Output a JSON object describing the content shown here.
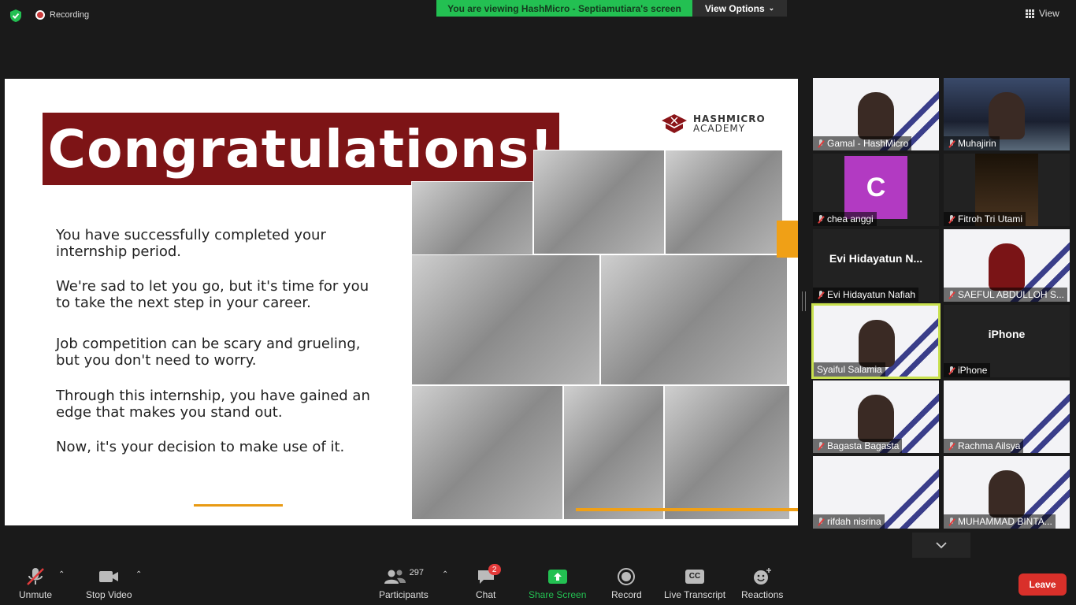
{
  "topbar": {
    "recording_label": "Recording",
    "viewing_banner": "You are viewing HashMicro - Septiamutiara's screen",
    "view_options": "View Options",
    "view_label": "View"
  },
  "slide": {
    "title": "Congratulations!",
    "logo_line1": "HASHMICRO",
    "logo_line2": "ACADEMY",
    "paragraphs": [
      "You have successfully completed your internship period.",
      "We're sad to let you go, but it's time for you to take the next step in your career.",
      "Job competition can be scary and grueling, but you don't need to worry.",
      "Through this internship, you have gained an edge that makes you stand out.",
      "Now, it's your decision to make use of it."
    ]
  },
  "participants": [
    {
      "name": "Gamal - HashMicro"
    },
    {
      "name": "Muhajirin"
    },
    {
      "name": "chea anggi",
      "avatar": "C"
    },
    {
      "name": "Fitroh Tri Utami"
    },
    {
      "name": "Evi Hidayatun Nafiah",
      "center": "Evi  Hidayatun  N..."
    },
    {
      "name": "SAEFUL ABDULLOH S..."
    },
    {
      "name": "Syaiful Salamia"
    },
    {
      "name": "iPhone",
      "center": "iPhone"
    },
    {
      "name": "Bagasta Bagasta"
    },
    {
      "name": "Rachma Ailsya"
    },
    {
      "name": "rifdah nisrina"
    },
    {
      "name": "MUHAMMAD BINTA..."
    }
  ],
  "toolbar": {
    "unmute": "Unmute",
    "stop_video": "Stop Video",
    "participants": "Participants",
    "participants_count": "297",
    "chat": "Chat",
    "chat_badge": "2",
    "share_screen": "Share Screen",
    "record": "Record",
    "live_transcript": "Live Transcript",
    "cc": "CC",
    "reactions": "Reactions",
    "leave": "Leave"
  },
  "colors": {
    "banner_green": "#23c052",
    "title_red": "#7d1416",
    "accent_orange": "#f0a016",
    "active_speaker": "#c8e04e",
    "leave_red": "#d9302a"
  }
}
